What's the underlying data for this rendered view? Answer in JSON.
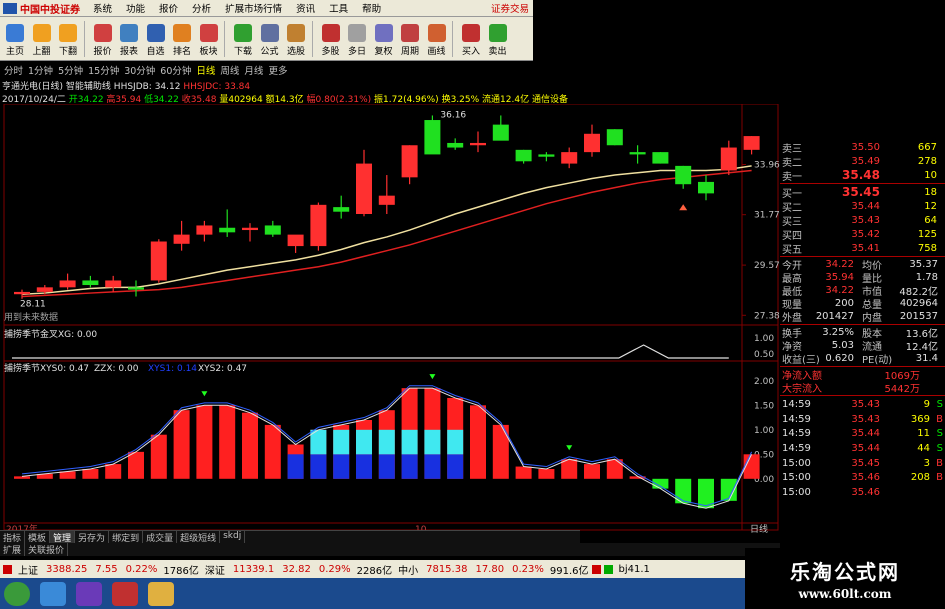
{
  "app": {
    "logo_text": "中国中投证券",
    "broker_link": "证券交易"
  },
  "menu": [
    "系统",
    "功能",
    "报价",
    "分析",
    "扩展市场行情",
    "资讯",
    "工具",
    "帮助"
  ],
  "toolbar": [
    {
      "label": "主页",
      "icon": "home-icon",
      "color": "#3a7bd5"
    },
    {
      "label": "上翻",
      "icon": "arrow-up-icon",
      "color": "#f0a020"
    },
    {
      "label": "下翻",
      "icon": "arrow-down-icon",
      "color": "#f0a020"
    },
    {
      "label": "报价",
      "icon": "quote-icon",
      "color": "#d04040"
    },
    {
      "label": "报表",
      "icon": "report-icon",
      "color": "#4080c0"
    },
    {
      "label": "自选",
      "icon": "f6-icon",
      "color": "#3060b0"
    },
    {
      "label": "排名",
      "icon": "rank-icon",
      "color": "#e08020"
    },
    {
      "label": "板块",
      "icon": "sector-icon",
      "color": "#d04040"
    },
    {
      "label": "下载",
      "icon": "download-icon",
      "color": "#30a030"
    },
    {
      "label": "公式",
      "icon": "formula-icon",
      "color": "#6070a0"
    },
    {
      "label": "选股",
      "icon": "pick-icon",
      "color": "#c08030"
    },
    {
      "label": "多股",
      "icon": "multi-icon",
      "color": "#c03030"
    },
    {
      "label": "多日",
      "icon": "multiday-icon",
      "color": "#a0a0a0"
    },
    {
      "label": "复权",
      "icon": "restore-icon",
      "color": "#7070c0"
    },
    {
      "label": "周期",
      "icon": "period-icon",
      "color": "#c04040"
    },
    {
      "label": "画线",
      "icon": "draw-icon",
      "color": "#d06030"
    },
    {
      "label": "买入",
      "icon": "buy-icon",
      "color": "#c03030"
    },
    {
      "label": "卖出",
      "icon": "sell-icon",
      "color": "#30a030"
    }
  ],
  "periods": {
    "items": [
      "分时",
      "1分钟",
      "5分钟",
      "15分钟",
      "30分钟",
      "60分钟",
      "日线",
      "周线",
      "月线",
      "更多"
    ],
    "active": "日线"
  },
  "title_line": {
    "name": "亨通光电(日线)",
    "indicator": "智能辅助线",
    "hhs_label": "HHSJDB: 34.12",
    "hhs2_label": "HHSJDC: 33.84"
  },
  "info_line": {
    "date": "2017/10/24/二",
    "open": "开34.22",
    "high": "高35.94",
    "low": "低34.22",
    "close": "收35.48",
    "vol": "量402964",
    "amt": "额14.3亿",
    "chg": "幅0.80(2.31%)",
    "amp": "振1.72(4.96%)",
    "turn": "换3.25%",
    "float": "流通12.4亿",
    "extra": "通信设备"
  },
  "chart_data": {
    "type": "candlestick",
    "price_axis": {
      "ticks": [
        "33.96",
        "31.77",
        "29.57",
        "27.38"
      ],
      "min": 27.0,
      "max": 36.6
    },
    "annotations": {
      "high_label": "36.16",
      "low_label": "28.11",
      "hint": "用到未来数据"
    },
    "candles": [
      [
        28.3,
        28.5,
        28.1,
        28.4
      ],
      [
        28.4,
        28.7,
        28.3,
        28.6
      ],
      [
        28.6,
        29.2,
        28.5,
        28.9
      ],
      [
        28.9,
        29.1,
        28.6,
        28.7
      ],
      [
        28.6,
        29.1,
        28.4,
        28.9
      ],
      [
        28.6,
        28.9,
        28.2,
        28.5
      ],
      [
        28.9,
        30.7,
        28.8,
        30.6
      ],
      [
        30.5,
        31.5,
        30.2,
        30.9
      ],
      [
        30.9,
        31.5,
        30.6,
        31.3
      ],
      [
        31.2,
        32.0,
        30.8,
        31.0
      ],
      [
        31.1,
        31.4,
        30.6,
        31.2
      ],
      [
        31.3,
        31.5,
        30.8,
        30.9
      ],
      [
        30.4,
        30.8,
        30.1,
        30.9
      ],
      [
        30.4,
        32.3,
        30.2,
        32.2
      ],
      [
        32.1,
        32.6,
        31.6,
        31.9
      ],
      [
        31.8,
        34.6,
        31.7,
        34.0
      ],
      [
        32.2,
        33.5,
        31.8,
        32.6
      ],
      [
        33.4,
        34.8,
        33.1,
        34.8
      ],
      [
        35.9,
        36.1,
        35.1,
        34.4
      ],
      [
        34.9,
        35.1,
        34.6,
        34.7
      ],
      [
        34.8,
        35.4,
        34.5,
        34.9
      ],
      [
        35.7,
        36.1,
        35.3,
        35.0
      ],
      [
        34.6,
        34.6,
        34.0,
        34.1
      ],
      [
        34.4,
        34.5,
        34.1,
        34.3
      ],
      [
        34.0,
        34.7,
        33.8,
        34.5
      ],
      [
        34.5,
        35.7,
        34.3,
        35.3
      ],
      [
        35.5,
        35.5,
        34.8,
        34.8
      ],
      [
        34.5,
        34.8,
        34.0,
        34.4
      ],
      [
        34.5,
        34.5,
        34.0,
        34.0
      ],
      [
        33.9,
        33.9,
        32.9,
        33.1
      ],
      [
        33.2,
        33.5,
        32.4,
        32.7
      ],
      [
        33.7,
        35.0,
        33.5,
        34.7
      ],
      [
        34.6,
        35.2,
        34.4,
        35.2
      ]
    ],
    "ma_fast": [
      28.3,
      28.35,
      28.45,
      28.55,
      28.6,
      28.6,
      28.75,
      28.95,
      29.15,
      29.35,
      29.5,
      29.65,
      29.8,
      30.0,
      30.25,
      30.55,
      30.8,
      31.1,
      31.45,
      31.8,
      32.1,
      32.4,
      32.7,
      32.95,
      33.15,
      33.35,
      33.5,
      33.6,
      33.7,
      33.7,
      33.7,
      33.75,
      33.9
    ],
    "ma_slow": [
      28.2,
      28.25,
      28.3,
      28.35,
      28.4,
      28.45,
      28.5,
      28.6,
      28.75,
      28.9,
      29.05,
      29.2,
      29.35,
      29.5,
      29.7,
      29.95,
      30.2,
      30.45,
      30.75,
      31.05,
      31.35,
      31.65,
      31.95,
      32.25,
      32.5,
      32.75,
      32.95,
      33.15,
      33.3,
      33.4,
      33.5,
      33.6,
      33.7
    ],
    "mid_panel": {
      "label": "捕捞季节金叉",
      "xg_label": "XG: 0.00",
      "ticks": [
        "1.00",
        "0.50"
      ]
    },
    "lower_panel": {
      "label": "捕捞季节",
      "xys0": "XYS0: 0.47",
      "zzx": "ZZX: 0.00",
      "xys1": "XYS1: 0.14",
      "xys2": "XYS2: 0.47",
      "ticks": [
        "2.00",
        "1.50",
        "1.00",
        "0.50",
        "0.00"
      ],
      "hist": [
        0.05,
        0.1,
        0.15,
        0.2,
        0.3,
        0.55,
        0.9,
        1.4,
        1.5,
        1.5,
        1.35,
        1.1,
        0.7,
        1.0,
        1.1,
        1.2,
        1.4,
        1.85,
        1.85,
        1.65,
        1.5,
        1.1,
        0.25,
        0.2,
        0.4,
        0.3,
        0.4,
        0.05,
        -0.2,
        -0.5,
        -0.6,
        -0.45,
        0.5
      ],
      "blue_segments": [
        0,
        0,
        0,
        0,
        0,
        0,
        0,
        0,
        0,
        0,
        0,
        0,
        0.5,
        0.5,
        0.5,
        0.5,
        0.5,
        0.5,
        0.5,
        0.5,
        0,
        0,
        0,
        0,
        0,
        0,
        0,
        0,
        0,
        0,
        0,
        0,
        0
      ],
      "cyan_segments": [
        0,
        0,
        0,
        0,
        0,
        0,
        0,
        0,
        0,
        0,
        0,
        0,
        0,
        0.5,
        0.5,
        0.5,
        0.5,
        0.5,
        0.5,
        0.5,
        0,
        0,
        0,
        0,
        0,
        0,
        0,
        0,
        0,
        0,
        0,
        0,
        0
      ]
    },
    "x_axis": {
      "labels": [
        "2017年",
        "10"
      ],
      "period_label": "日线"
    }
  },
  "side": {
    "asks": [
      {
        "label": "卖三",
        "price": "35.50",
        "vol": "667"
      },
      {
        "label": "卖二",
        "price": "35.49",
        "vol": "278"
      },
      {
        "label": "卖一",
        "price": "35.48",
        "vol": "10"
      }
    ],
    "bids": [
      {
        "label": "买一",
        "price": "35.45",
        "vol": "18"
      },
      {
        "label": "买二",
        "price": "35.44",
        "vol": "12"
      },
      {
        "label": "买三",
        "price": "35.43",
        "vol": "64"
      },
      {
        "label": "买四",
        "price": "35.42",
        "vol": "125"
      },
      {
        "label": "买五",
        "price": "35.41",
        "vol": "758"
      }
    ],
    "quotes": [
      [
        "今开",
        "34.22",
        "均价",
        "35.37"
      ],
      [
        "最高",
        "35.94",
        "量比",
        "1.78"
      ],
      [
        "最低",
        "34.22",
        "市值",
        "482.2亿"
      ],
      [
        "现量",
        "200",
        "总量",
        "402964"
      ],
      [
        "外盘",
        "201427",
        "内盘",
        "201537"
      ]
    ],
    "quotes2": [
      [
        "换手",
        "3.25%",
        "股本",
        "13.6亿"
      ],
      [
        "净资",
        "5.03",
        "流通",
        "12.4亿"
      ],
      [
        "收益(三)",
        "0.620",
        "PE(动)",
        "31.4"
      ]
    ],
    "flows": [
      [
        "净流入额",
        "1069万"
      ],
      [
        "大宗流入",
        "5442万"
      ]
    ],
    "ticks": [
      [
        "14:59",
        "35.43",
        "9",
        "S"
      ],
      [
        "14:59",
        "35.43",
        "369",
        "B"
      ],
      [
        "14:59",
        "35.44",
        "11",
        "S"
      ],
      [
        "14:59",
        "35.44",
        "44",
        "S"
      ],
      [
        "15:00",
        "35.45",
        "3",
        "B"
      ],
      [
        "15:00",
        "35.46",
        "208",
        "B"
      ],
      [
        "15:00",
        "35.46",
        "",
        ""
      ]
    ]
  },
  "bottom_tabs": [
    "指标",
    "模板",
    "管理",
    "另存为",
    "绑定到",
    "成交量",
    "超级短线",
    "skdj"
  ],
  "extra_tabs": [
    "扩展",
    "关联报价"
  ],
  "ticker": {
    "sh": "上证",
    "sh_val": "3388.25",
    "sh_chg": "7.55",
    "sh_pct": "0.22%",
    "sh_amt": "1786亿",
    "sz": "深证",
    "sz_val": "11339.1",
    "sz_chg": "32.82",
    "sz_pct": "0.29%",
    "sz_amt": "2286亿",
    "zx": "中小",
    "zx_val": "7815.38",
    "zx_chg": "17.80",
    "zx_pct": "0.23%",
    "zx_amt": "991.6亿",
    "tail": "bj41.1"
  },
  "watermark": {
    "line1": "乐淘公式网",
    "line2": "www.60lt.com"
  }
}
